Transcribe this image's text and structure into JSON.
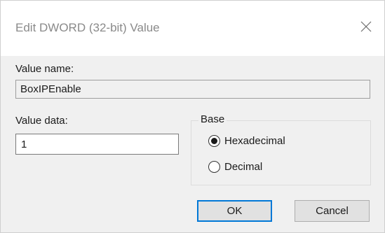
{
  "window": {
    "title": "Edit DWORD (32-bit) Value",
    "close_icon": "close-icon"
  },
  "value_name": {
    "label": "Value name:",
    "value": "BoxIPEnable"
  },
  "value_data": {
    "label": "Value data:",
    "value": "1"
  },
  "base": {
    "legend": "Base",
    "options": [
      {
        "label": "Hexadecimal",
        "selected": true
      },
      {
        "label": "Decimal",
        "selected": false
      }
    ]
  },
  "buttons": {
    "ok": "OK",
    "cancel": "Cancel"
  },
  "colors": {
    "accent": "#0078d7",
    "dialog_bg": "#f0f0f0",
    "titlebar_bg": "#ffffff"
  }
}
